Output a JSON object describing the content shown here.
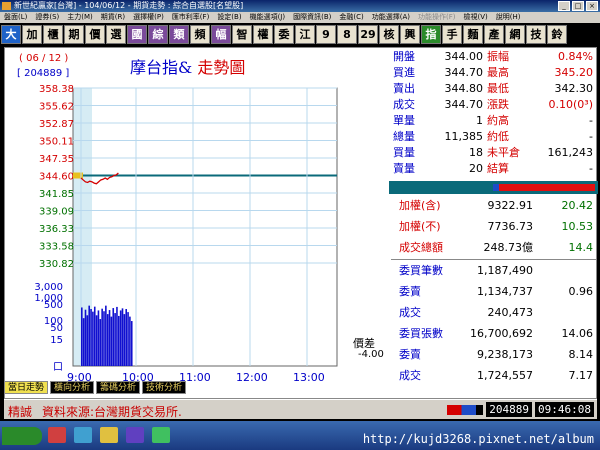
{
  "window": {
    "title": "新世紀贏家[台灣] - 104/06/12 - 期貨走勢 : 綜合自選股[名望股]"
  },
  "menu": [
    {
      "label": "盤面(L)"
    },
    {
      "label": "證券(S)"
    },
    {
      "label": "主力(M)"
    },
    {
      "label": "期貨(R)"
    },
    {
      "label": "選擇權(P)"
    },
    {
      "label": "匯市利率(F)"
    },
    {
      "label": "設定(B)"
    },
    {
      "label": "機能選項(J)"
    },
    {
      "label": "國際資訊(B)"
    },
    {
      "label": "金融(C)"
    },
    {
      "label": "功能選擇(A)"
    },
    {
      "label": "功能操作(F)",
      "dim": true
    },
    {
      "label": "檢視(V)"
    },
    {
      "label": "說明(H)"
    }
  ],
  "toolbar": [
    {
      "label": "大",
      "style": "act"
    },
    {
      "label": "加"
    },
    {
      "label": "櫃"
    },
    {
      "label": "期"
    },
    {
      "label": "價"
    },
    {
      "label": "選"
    },
    {
      "label": "國",
      "style": "purp"
    },
    {
      "label": "綜",
      "style": "purp"
    },
    {
      "label": "類",
      "style": "purp"
    },
    {
      "label": "頻"
    },
    {
      "label": "幅",
      "style": "purp"
    },
    {
      "label": "智"
    },
    {
      "label": "權"
    },
    {
      "label": "委"
    },
    {
      "label": "江"
    },
    {
      "label": "9"
    },
    {
      "label": "8"
    },
    {
      "label": "29"
    },
    {
      "label": "核"
    },
    {
      "label": "興"
    },
    {
      "label": "指",
      "style": "grn"
    },
    {
      "label": "手"
    },
    {
      "label": "麵"
    },
    {
      "label": "產"
    },
    {
      "label": "網"
    },
    {
      "label": "技"
    },
    {
      "label": "鈴"
    }
  ],
  "chart_header": {
    "date": "( 06 / 12 )",
    "code": "[ 204889 ]",
    "title_a": "摩台指&",
    "title_b": "走勢圖"
  },
  "chart_data": {
    "type": "line",
    "x_ticks": [
      "9:00",
      "10:00",
      "11:00",
      "12:00",
      "13:00"
    ],
    "y_price_ticks": [
      "358.38",
      "355.62",
      "352.87",
      "350.11",
      "347.35",
      "344.60",
      "341.85",
      "339.09",
      "336.33",
      "333.58",
      "330.82"
    ],
    "reference_price": 344.6,
    "ylim": [
      330.82,
      358.38
    ],
    "series": [
      {
        "values": [
          344.2,
          343.9,
          343.6,
          343.5,
          343.7,
          343.6,
          343.4,
          343.3,
          343.6,
          343.9,
          344.0,
          344.2,
          344.0,
          344.3,
          344.4,
          344.6,
          344.7,
          345.0
        ]
      }
    ],
    "volume_ticks": [
      "3,000",
      "1,000",
      "500",
      "100",
      "50",
      "15",
      "口"
    ],
    "volume_scale": "log",
    "volume_ylim": [
      1,
      3000
    ],
    "volume": [
      350,
      120,
      280,
      160,
      420,
      300,
      230,
      380,
      160,
      260,
      110,
      310,
      240,
      420,
      180,
      270,
      140,
      330,
      200,
      370,
      150,
      260,
      320,
      180,
      300,
      220,
      140,
      90
    ],
    "volume_xlim": [
      0,
      275
    ],
    "grid": true
  },
  "diff": {
    "label": "價差",
    "value": "-4.00"
  },
  "quote": [
    {
      "l1": "開盤",
      "v1": "344.00",
      "l2": "振幅",
      "v2": "0.84%",
      "c2": "#d40000"
    },
    {
      "l1": "買進",
      "v1": "344.70",
      "l2": "最高",
      "v2": "345.20",
      "c2": "#d40000"
    },
    {
      "l1": "賣出",
      "v1": "344.80",
      "l2": "最低",
      "v2": "342.30",
      "c2": "#000"
    },
    {
      "l1": "成交",
      "v1": "344.70",
      "l2": "漲跌",
      "v2": "0.10(0³)",
      "c2": "#d40000"
    },
    {
      "l1": "單量",
      "v1": "1",
      "l2": "約高",
      "v2": "-",
      "c2": "#000"
    },
    {
      "l1": "總量",
      "v1": "11,385",
      "l2": "約低",
      "v2": "-",
      "c2": "#000"
    },
    {
      "l1": "買量",
      "v1": "18",
      "l2": "未平倉",
      "v2": "161,243",
      "c2": "#000"
    },
    {
      "l1": "賣量",
      "v1": "20",
      "l2": "結算",
      "v2": "-",
      "c2": "#000"
    }
  ],
  "indices": [
    {
      "label": "加權(含)",
      "v1": "9322.91",
      "v2": "20.42"
    },
    {
      "label": "加權(不)",
      "v1": "7736.73",
      "v2": "10.53"
    },
    {
      "label": "成交總額",
      "v1": "248.73億",
      "v2": "14.4"
    }
  ],
  "futures": [
    {
      "label": "委買筆數",
      "v1": "1,187,490",
      "v2": ""
    },
    {
      "label": "委賣",
      "v1": "1,134,737",
      "v2": "0.96"
    },
    {
      "label": "成交",
      "v1": "240,473",
      "v2": ""
    },
    {
      "label": "委買張數",
      "v1": "16,700,692",
      "v2": "14.06"
    },
    {
      "label": "委賣",
      "v1": "9,238,173",
      "v2": "8.14"
    },
    {
      "label": "成交",
      "v1": "1,724,557",
      "v2": "7.17"
    }
  ],
  "tabs": [
    {
      "label": "當日走勢",
      "active": true
    },
    {
      "label": "橫向分析"
    },
    {
      "label": "籌碼分析"
    },
    {
      "label": "技術分析"
    }
  ],
  "status": {
    "left": "精誠",
    "source": "資料來源:台灣期貨交易所.",
    "code": "204889",
    "time": "09:46:08"
  },
  "watermark": "http://kujd3268.pixnet.net/album"
}
